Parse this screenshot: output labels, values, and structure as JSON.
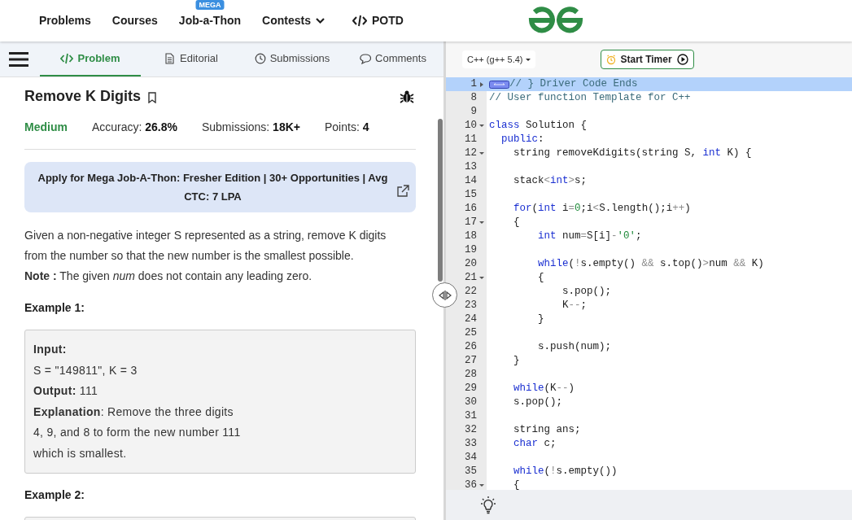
{
  "nav": {
    "items": [
      {
        "label": "Problems",
        "kind": "link"
      },
      {
        "label": "Courses",
        "kind": "link"
      },
      {
        "label": "Job-a-Thon",
        "kind": "badge_link",
        "badge": "MEGA"
      },
      {
        "label": "Contests",
        "kind": "dropdown"
      },
      {
        "label": "POTD",
        "kind": "code_link"
      }
    ]
  },
  "tabs": [
    {
      "label": "Problem",
      "selected": true
    },
    {
      "label": "Editorial",
      "selected": false
    },
    {
      "label": "Submissions",
      "selected": false
    },
    {
      "label": "Comments",
      "selected": false
    }
  ],
  "problem": {
    "title": "Remove K Digits",
    "difficulty": "Medium",
    "stats": [
      {
        "label": "Accuracy:",
        "value": "26.8%"
      },
      {
        "label": "Submissions:",
        "value": "18K+"
      },
      {
        "label": "Points:",
        "value": "4"
      }
    ],
    "banner": "Apply for Mega Job-A-Thon: Fresher Edition | 30+ Opportunities | Avg CTC: 7 LPA",
    "description": [
      "Given a non-negative integer S represented as a string, remove K digits from the number so that the new number is the smallest possible.",
      "**Note :** The given *num* does not contain any leading zero."
    ],
    "examples": [
      {
        "heading": "Example 1:",
        "lines": [
          "**Input:**",
          "S = \"149811\", K = 3",
          "**Output:** 111",
          "**Explanation**: Remove the three digits",
          "4, 9, and 8 to form the new number 111",
          "which is smallest."
        ]
      },
      {
        "heading": "Example 2:"
      }
    ]
  },
  "editor": {
    "language": "C++ (g++ 5.4)",
    "timer_button": "Start Timer",
    "lines": [
      {
        "number": "1",
        "foldable": true,
        "expanded": false,
        "highlighted": true,
        "tokens": [
          {
            "kind": "comment",
            "text": "// } Driver Code Ends"
          }
        ]
      },
      {
        "number": "8",
        "foldable": false,
        "highlighted": false,
        "tokens": [
          {
            "kind": "comment",
            "text": "// User function Template for C++"
          }
        ]
      },
      {
        "number": "9",
        "foldable": false,
        "highlighted": false
      },
      {
        "number": "10",
        "foldable": true,
        "expanded": true,
        "highlighted": false,
        "tokens": [
          {
            "kind": "keyword",
            "text": "class"
          },
          {
            "kind": "plain",
            "text": " Solution {"
          }
        ]
      },
      {
        "number": "11",
        "foldable": false,
        "highlighted": false,
        "tokens": [
          {
            "kind": "keyword",
            "text": "  public"
          },
          {
            "kind": "plain",
            "text": ":"
          }
        ]
      },
      {
        "number": "12",
        "foldable": true,
        "expanded": true,
        "highlighted": false,
        "tokens": [
          {
            "kind": "plain",
            "text": "    string removeKdigits(string S, "
          },
          {
            "kind": "keyword",
            "text": "int"
          },
          {
            "kind": "plain",
            "text": " K) {"
          }
        ]
      },
      {
        "number": "13",
        "foldable": false,
        "highlighted": false
      },
      {
        "number": "14",
        "foldable": false,
        "highlighted": false,
        "tokens": [
          {
            "kind": "plain",
            "text": "    stack"
          },
          {
            "kind": "op",
            "text": "<"
          },
          {
            "kind": "keyword",
            "text": "int"
          },
          {
            "kind": "op",
            "text": ">"
          },
          {
            "kind": "plain",
            "text": "s;"
          }
        ]
      },
      {
        "number": "15",
        "foldable": false,
        "highlighted": false
      },
      {
        "number": "16",
        "foldable": false,
        "highlighted": false,
        "tokens": [
          {
            "kind": "keyword",
            "text": "    for"
          },
          {
            "kind": "plain",
            "text": "("
          },
          {
            "kind": "keyword",
            "text": "int"
          },
          {
            "kind": "plain",
            "text": " i"
          },
          {
            "kind": "op",
            "text": "="
          },
          {
            "kind": "number",
            "text": "0"
          },
          {
            "kind": "plain",
            "text": ";i"
          },
          {
            "kind": "op",
            "text": "<"
          },
          {
            "kind": "plain",
            "text": "S.length();i"
          },
          {
            "kind": "op",
            "text": "++"
          },
          {
            "kind": "plain",
            "text": ")"
          }
        ]
      },
      {
        "number": "17",
        "foldable": true,
        "expanded": true,
        "highlighted": false,
        "tokens": [
          {
            "kind": "plain",
            "text": "    {"
          }
        ]
      },
      {
        "number": "18",
        "foldable": false,
        "highlighted": false,
        "tokens": [
          {
            "kind": "keyword",
            "text": "        int"
          },
          {
            "kind": "plain",
            "text": " num"
          },
          {
            "kind": "op",
            "text": "="
          },
          {
            "kind": "plain",
            "text": "S[i]"
          },
          {
            "kind": "op",
            "text": "-"
          },
          {
            "kind": "string",
            "text": "'0'"
          },
          {
            "kind": "plain",
            "text": ";"
          }
        ]
      },
      {
        "number": "19",
        "foldable": false,
        "highlighted": false
      },
      {
        "number": "20",
        "foldable": false,
        "highlighted": false,
        "tokens": [
          {
            "kind": "keyword",
            "text": "        while"
          },
          {
            "kind": "plain",
            "text": "("
          },
          {
            "kind": "op",
            "text": "!"
          },
          {
            "kind": "plain",
            "text": "s.empty() "
          },
          {
            "kind": "op",
            "text": "&&"
          },
          {
            "kind": "plain",
            "text": " s.top()"
          },
          {
            "kind": "op",
            "text": ">"
          },
          {
            "kind": "plain",
            "text": "num "
          },
          {
            "kind": "op",
            "text": "&&"
          },
          {
            "kind": "plain",
            "text": " K)"
          }
        ]
      },
      {
        "number": "21",
        "foldable": true,
        "expanded": true,
        "highlighted": false,
        "tokens": [
          {
            "kind": "plain",
            "text": "        {"
          }
        ]
      },
      {
        "number": "22",
        "foldable": false,
        "highlighted": false,
        "tokens": [
          {
            "kind": "plain",
            "text": "            s.pop();"
          }
        ]
      },
      {
        "number": "23",
        "foldable": false,
        "highlighted": false,
        "tokens": [
          {
            "kind": "plain",
            "text": "            K"
          },
          {
            "kind": "op",
            "text": "--"
          },
          {
            "kind": "plain",
            "text": ";"
          }
        ]
      },
      {
        "number": "24",
        "foldable": false,
        "highlighted": false,
        "tokens": [
          {
            "kind": "plain",
            "text": "        }"
          }
        ]
      },
      {
        "number": "25",
        "foldable": false,
        "highlighted": false
      },
      {
        "number": "26",
        "foldable": false,
        "highlighted": false,
        "tokens": [
          {
            "kind": "plain",
            "text": "        s.push(num);"
          }
        ]
      },
      {
        "number": "27",
        "foldable": false,
        "highlighted": false,
        "tokens": [
          {
            "kind": "plain",
            "text": "    }"
          }
        ]
      },
      {
        "number": "28",
        "foldable": false,
        "highlighted": false
      },
      {
        "number": "29",
        "foldable": false,
        "highlighted": false,
        "tokens": [
          {
            "kind": "keyword",
            "text": "    while"
          },
          {
            "kind": "plain",
            "text": "(K"
          },
          {
            "kind": "op",
            "text": "--"
          },
          {
            "kind": "plain",
            "text": ")"
          }
        ]
      },
      {
        "number": "30",
        "foldable": false,
        "highlighted": false,
        "tokens": [
          {
            "kind": "plain",
            "text": "    s.pop();"
          }
        ]
      },
      {
        "number": "31",
        "foldable": false,
        "highlighted": false
      },
      {
        "number": "32",
        "foldable": false,
        "highlighted": false,
        "tokens": [
          {
            "kind": "plain",
            "text": "    string ans;"
          }
        ]
      },
      {
        "number": "33",
        "foldable": false,
        "highlighted": false,
        "tokens": [
          {
            "kind": "keyword",
            "text": "    char"
          },
          {
            "kind": "plain",
            "text": " c;"
          }
        ]
      },
      {
        "number": "34",
        "foldable": false,
        "highlighted": false
      },
      {
        "number": "35",
        "foldable": false,
        "highlighted": false,
        "tokens": [
          {
            "kind": "keyword",
            "text": "    while"
          },
          {
            "kind": "plain",
            "text": "("
          },
          {
            "kind": "op",
            "text": "!"
          },
          {
            "kind": "plain",
            "text": "s.empty())"
          }
        ]
      },
      {
        "number": "36",
        "foldable": true,
        "expanded": true,
        "highlighted": false,
        "tokens": [
          {
            "kind": "plain",
            "text": "    {"
          }
        ]
      }
    ]
  }
}
